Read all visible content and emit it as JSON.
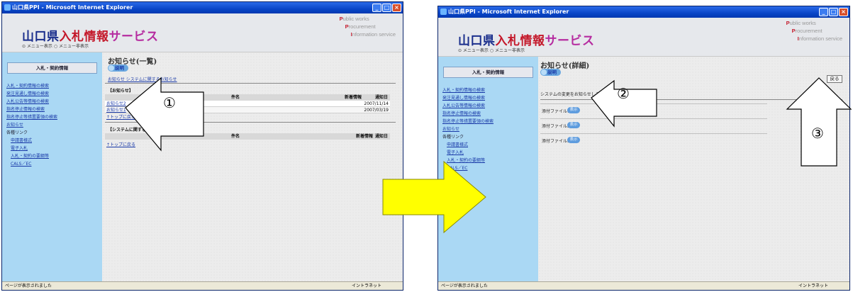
{
  "colors": {
    "arrow_yellow": "#ffff00",
    "sidebar": "#aad8f4",
    "title_bar": "#0a46c8",
    "logo_blue": "#1a2e8c",
    "logo_red": "#c4182a"
  },
  "window_title": "山口県PPI - Microsoft Internet Explorer",
  "header": {
    "logo_part1": "山口県",
    "logo_part2": "入札情報",
    "logo_part3": "サービス",
    "menu_options": "⊙ メニュー表示 ○ メニュー非表示",
    "tagline": [
      {
        "initial": "P",
        "rest": "ublic works"
      },
      {
        "initial": "P",
        "rest": "rocurement"
      },
      {
        "initial": "I",
        "rest": "nformation service"
      }
    ]
  },
  "sidebar": {
    "heading": "入札・契約情報",
    "links": [
      "入札・契約情報の検索",
      "発注見通し情報の検索",
      "入札公告等情報の検索",
      "指名停止情報の検索",
      "指名停止等措置要領の検索",
      "お知らせ"
    ],
    "links_title": "各種リンク",
    "sub_links": [
      "申請書様式",
      "電子入札",
      "入札・契約の要綱等",
      "CALS／EC"
    ]
  },
  "list_page": {
    "title": "お知らせ(一覧)",
    "help_label": "説明",
    "top_links": "お知らせ システムに関するお知らせ",
    "section1": "【お知らせ】",
    "col_subject": "件名",
    "col_new": "新着情報",
    "col_date": "通知日",
    "rows": [
      {
        "subject": "お知らせ2",
        "date": "2007/11/14"
      },
      {
        "subject": "お知らせ1",
        "date": "2007/03/19"
      }
    ],
    "back_to_top": "↑トップに戻る",
    "section2": "【システムに関するお知らせ】"
  },
  "detail_page": {
    "title": "お知らせ(詳細)",
    "help_label": "説明",
    "back_button": "戻る",
    "message": "システムの変更をお知らせします",
    "attachments": [
      {
        "label": "添付ファイル1",
        "button": "表示"
      },
      {
        "label": "添付ファイル2",
        "button": "表示"
      },
      {
        "label": "添付ファイル3",
        "button": "表示"
      }
    ]
  },
  "status_bar": {
    "text": "ページが表示されました",
    "zone": "イントラネット"
  },
  "callouts": {
    "one": "①",
    "two": "②",
    "three": "③"
  }
}
